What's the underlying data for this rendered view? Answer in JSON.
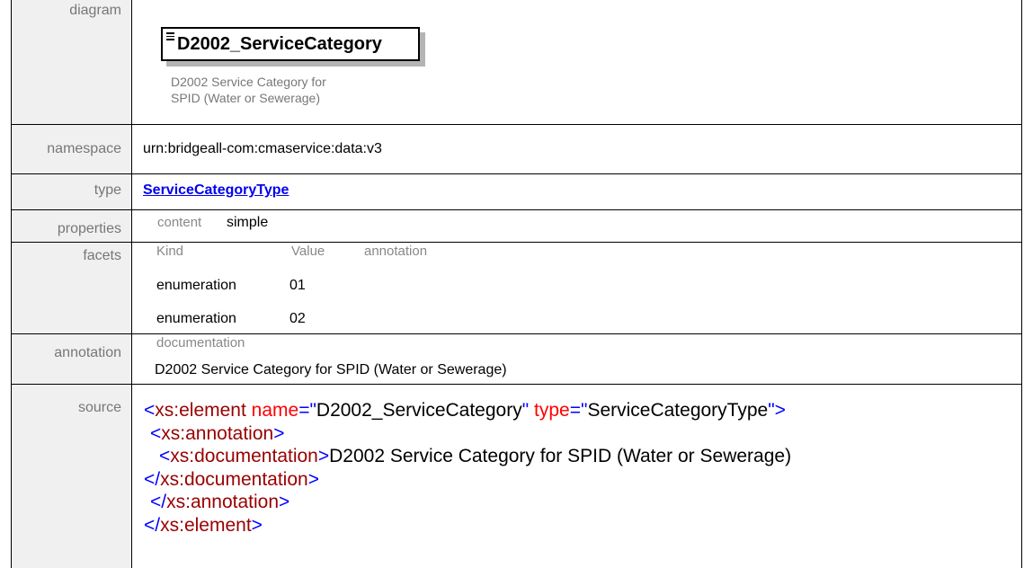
{
  "labels": {
    "diagram": "diagram",
    "namespace": "namespace",
    "type": "type",
    "properties": "properties",
    "facets": "facets",
    "annotation": "annotation",
    "source": "source"
  },
  "diagram": {
    "element_name": "D2002_ServiceCategory",
    "doc_line1": "D2002 Service Category for",
    "doc_line2": "SPID (Water or Sewerage)"
  },
  "namespace": "urn:bridgeall-com:cmaservice:data:v3",
  "type_link": "ServiceCategoryType",
  "properties": {
    "key": "content",
    "value": "simple"
  },
  "facets": {
    "headers": [
      "Kind",
      "Value",
      "annotation"
    ],
    "rows": [
      {
        "kind": "enumeration",
        "value": "01"
      },
      {
        "kind": "enumeration",
        "value": "02"
      }
    ]
  },
  "annotation": {
    "heading": "documentation",
    "text": "D2002 Service Category for SPID (Water or Sewerage)"
  },
  "source": {
    "line1": {
      "open": "<",
      "tag": "xs:element",
      "attr1": "name",
      "eq": "=\"",
      "val1": "D2002_ServiceCategory",
      "q": "\"",
      "attr2": "type",
      "val2": "ServiceCategoryType",
      "close": "\">"
    },
    "line2": {
      "open": "<",
      "tag": "xs:annotation",
      "close": ">"
    },
    "line3": {
      "open": "<",
      "tag": "xs:documentation",
      "close": ">",
      "text": "D2002 Service Category for SPID (Water or Sewerage)"
    },
    "line4": {
      "open": "</",
      "tag": "xs:documentation",
      "close": ">"
    },
    "line5": {
      "open": "</",
      "tag": "xs:annotation",
      "close": ">"
    },
    "line6": {
      "open": "</",
      "tag": "xs:element",
      "close": ">"
    }
  }
}
